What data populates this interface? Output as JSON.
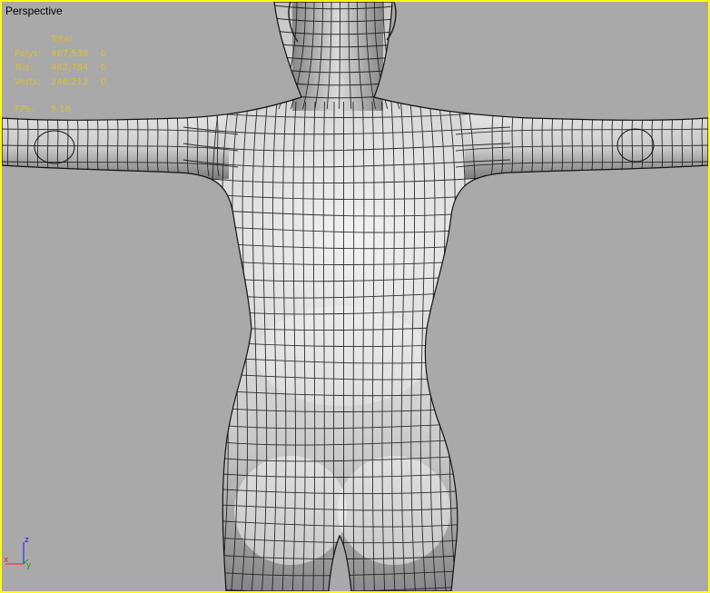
{
  "viewport": {
    "label": "Perspective",
    "stats": {
      "header": "Total",
      "rows": [
        {
          "label": "Polys:",
          "value": "467,538",
          "selected": "0"
        },
        {
          "label": "Tris:",
          "value": "462,784",
          "selected": "0"
        },
        {
          "label": "Verts:",
          "value": "246,212",
          "selected": "0"
        }
      ],
      "fps_label": "FPS:",
      "fps_value": "9.18"
    },
    "axis": {
      "z": "z",
      "x": "x",
      "y": "y"
    }
  },
  "colors": {
    "active_border": "#ffff00",
    "stats_text": "#d8c13a",
    "viewport_bg": "#a9a9a9"
  }
}
